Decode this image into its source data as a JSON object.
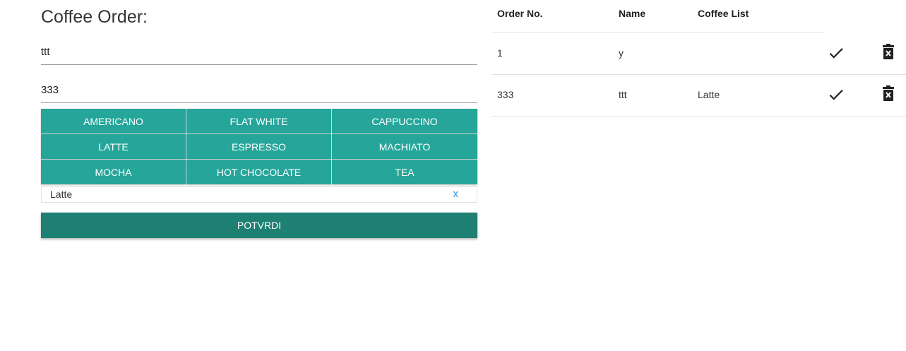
{
  "form": {
    "title": "Coffee Order:",
    "name_value": "ttt",
    "number_value": "333"
  },
  "coffee_buttons": [
    "AMERICANO",
    "FLAT WHITE",
    "CAPPUCCINO",
    "LATTE",
    "ESPRESSO",
    "MACHIATO",
    "MOCHA",
    "HOT CHOCOLATE",
    "TEA"
  ],
  "selected": [
    {
      "label": "Latte",
      "remove": "x"
    }
  ],
  "confirm_label": "POTVRDI",
  "table": {
    "headers": [
      "Order No.",
      "Name",
      "Coffee List"
    ],
    "rows": [
      {
        "order_no": "1",
        "name": "y",
        "coffee_list": ""
      },
      {
        "order_no": "333",
        "name": "ttt",
        "coffee_list": "Latte"
      }
    ]
  },
  "colors": {
    "accent": "#26a69a",
    "confirm": "#1e7f73",
    "link": "#2196f3"
  },
  "icons": {
    "done": "check-icon",
    "delete": "trash-icon"
  }
}
